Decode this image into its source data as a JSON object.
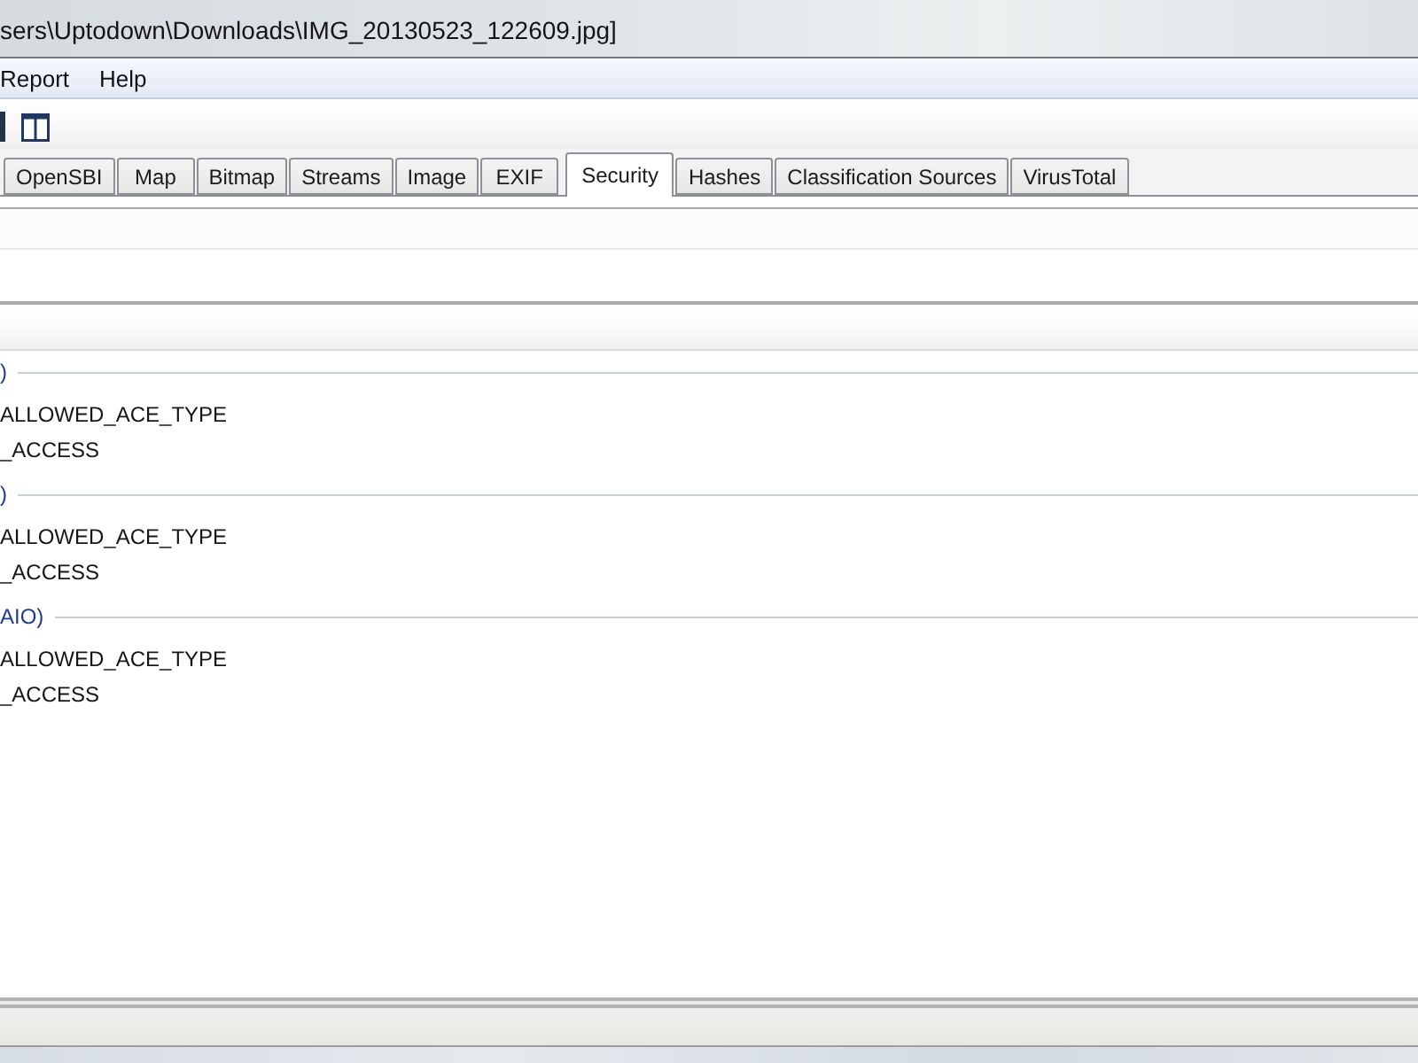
{
  "window": {
    "title": "sers\\Uptodown\\Downloads\\IMG_20130523_122609.jpg]"
  },
  "menu": [
    {
      "label": "Report"
    },
    {
      "label": "Help"
    }
  ],
  "tabs": [
    {
      "label": "OpenSBI",
      "selected": false
    },
    {
      "label": "Map",
      "selected": false
    },
    {
      "label": "Bitmap",
      "selected": false
    },
    {
      "label": "Streams",
      "selected": false
    },
    {
      "label": "Image",
      "selected": false
    },
    {
      "label": "EXIF",
      "selected": false
    },
    {
      "label": "Security",
      "selected": true
    },
    {
      "label": "Hashes",
      "selected": false
    },
    {
      "label": "Classification Sources",
      "selected": false
    },
    {
      "label": "VirusTotal",
      "selected": false
    }
  ],
  "security_list": {
    "groups": [
      {
        "header": ")",
        "items": [
          "ALLOWED_ACE_TYPE",
          "_ACCESS"
        ]
      },
      {
        "header": ")",
        "items": [
          "ALLOWED_ACE_TYPE",
          "_ACCESS"
        ]
      },
      {
        "header": "AIO)",
        "items": [
          "ALLOWED_ACE_TYPE",
          "_ACCESS"
        ]
      }
    ]
  }
}
